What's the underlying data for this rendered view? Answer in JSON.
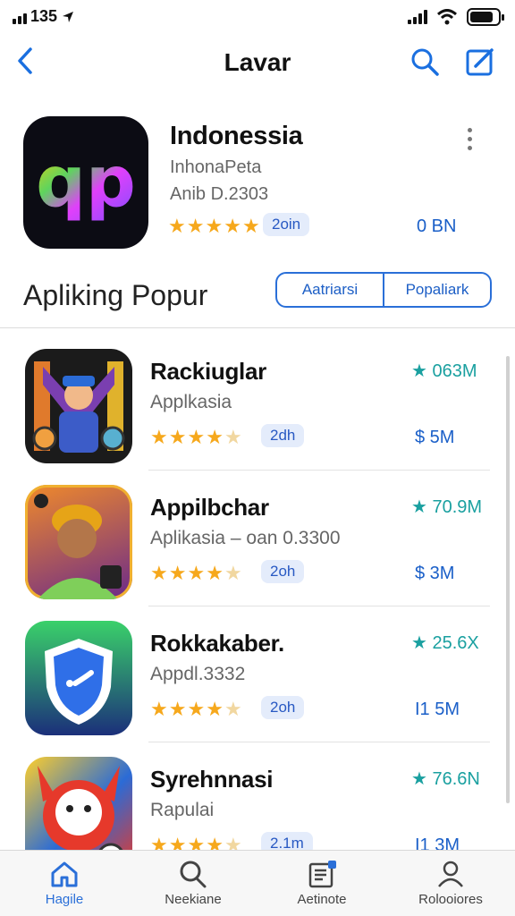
{
  "status_bar": {
    "time": "135"
  },
  "nav": {
    "title": "Lavar"
  },
  "featured": {
    "title": "Indonessia",
    "subtitle1": "InhonaPeta",
    "subtitle2": "Anib D.2303",
    "rating": 5,
    "badge": "2oin",
    "size": "0 BN",
    "icon_text": "qp"
  },
  "section": {
    "title": "Apliking Popur",
    "segments": [
      "Aatriarsi",
      "Popaliark"
    ]
  },
  "apps": [
    {
      "name": "Rackiuglar",
      "subtitle": "Applkasia",
      "rating": 4,
      "badge": "2dh",
      "downloads": "★ 063M",
      "size": "$ 5M",
      "icon": "character-robot-icon"
    },
    {
      "name": "Appilbchar",
      "subtitle": "Aplikasia – oan 0.3300",
      "rating": 4,
      "badge": "2oh",
      "downloads": "★ 70.9M",
      "size": "$ 3M",
      "icon": "portrait-icon"
    },
    {
      "name": "Rokkakaber.",
      "subtitle": "Appdl.3332",
      "rating": 4,
      "badge": "2oh",
      "downloads": "★ 25.6X",
      "size": "I1 5M",
      "icon": "shield-icon"
    },
    {
      "name": "Syrehnnasi",
      "subtitle": "Rapulai",
      "rating": 4,
      "badge": "2.1m",
      "downloads": "★ 76.6N",
      "size": "I1 3M",
      "icon": "game-character-icon"
    }
  ],
  "tabs": [
    {
      "label": "Hagile",
      "icon": "home-icon",
      "active": true
    },
    {
      "label": "Neekiane",
      "icon": "search-icon",
      "active": false
    },
    {
      "label": "Aetinote",
      "icon": "news-icon",
      "active": false
    },
    {
      "label": "Rolooiores",
      "icon": "person-icon",
      "active": false
    }
  ],
  "colors": {
    "accent": "#2a6fd8",
    "star": "#f6a81c",
    "teal": "#1aa0a0"
  }
}
